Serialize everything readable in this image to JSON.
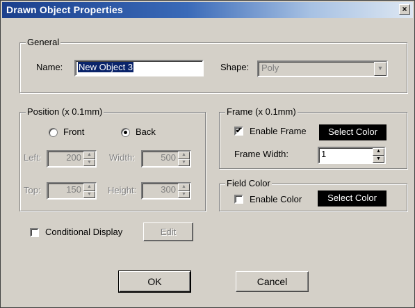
{
  "window": {
    "title": "Drawn Object Properties",
    "close_glyph": "×"
  },
  "general": {
    "legend": "General",
    "name_label": "Name:",
    "name_value": "New Object 3",
    "shape_label": "Shape:",
    "shape_value": "Poly",
    "shape_dropdown_glyph": "▼"
  },
  "position": {
    "legend": "Position (x 0.1mm)",
    "front_label": "Front",
    "back_label": "Back",
    "selected": "Back",
    "left_label": "Left:",
    "left_value": "200",
    "width_label": "Width:",
    "width_value": "500",
    "top_label": "Top:",
    "top_value": "150",
    "height_label": "Height:",
    "height_value": "300"
  },
  "frame": {
    "legend": "Frame (x 0.1mm)",
    "enable_label": "Enable Frame",
    "enable_checked": true,
    "select_color_label": "Select Color",
    "width_label": "Frame Width:",
    "width_value": "1"
  },
  "field_color": {
    "legend": "Field Color",
    "enable_label": "Enable Color",
    "enable_checked": false,
    "select_color_label": "Select Color"
  },
  "conditional": {
    "label": "Conditional Display",
    "checked": false,
    "edit_label": "Edit"
  },
  "buttons": {
    "ok_label": "OK",
    "cancel_label": "Cancel"
  },
  "glyphs": {
    "check": "✔",
    "spin_up": "▲",
    "spin_down": "▼"
  },
  "colors": {
    "select_color_button": "#000000",
    "selection_highlight": "#0a246a"
  }
}
